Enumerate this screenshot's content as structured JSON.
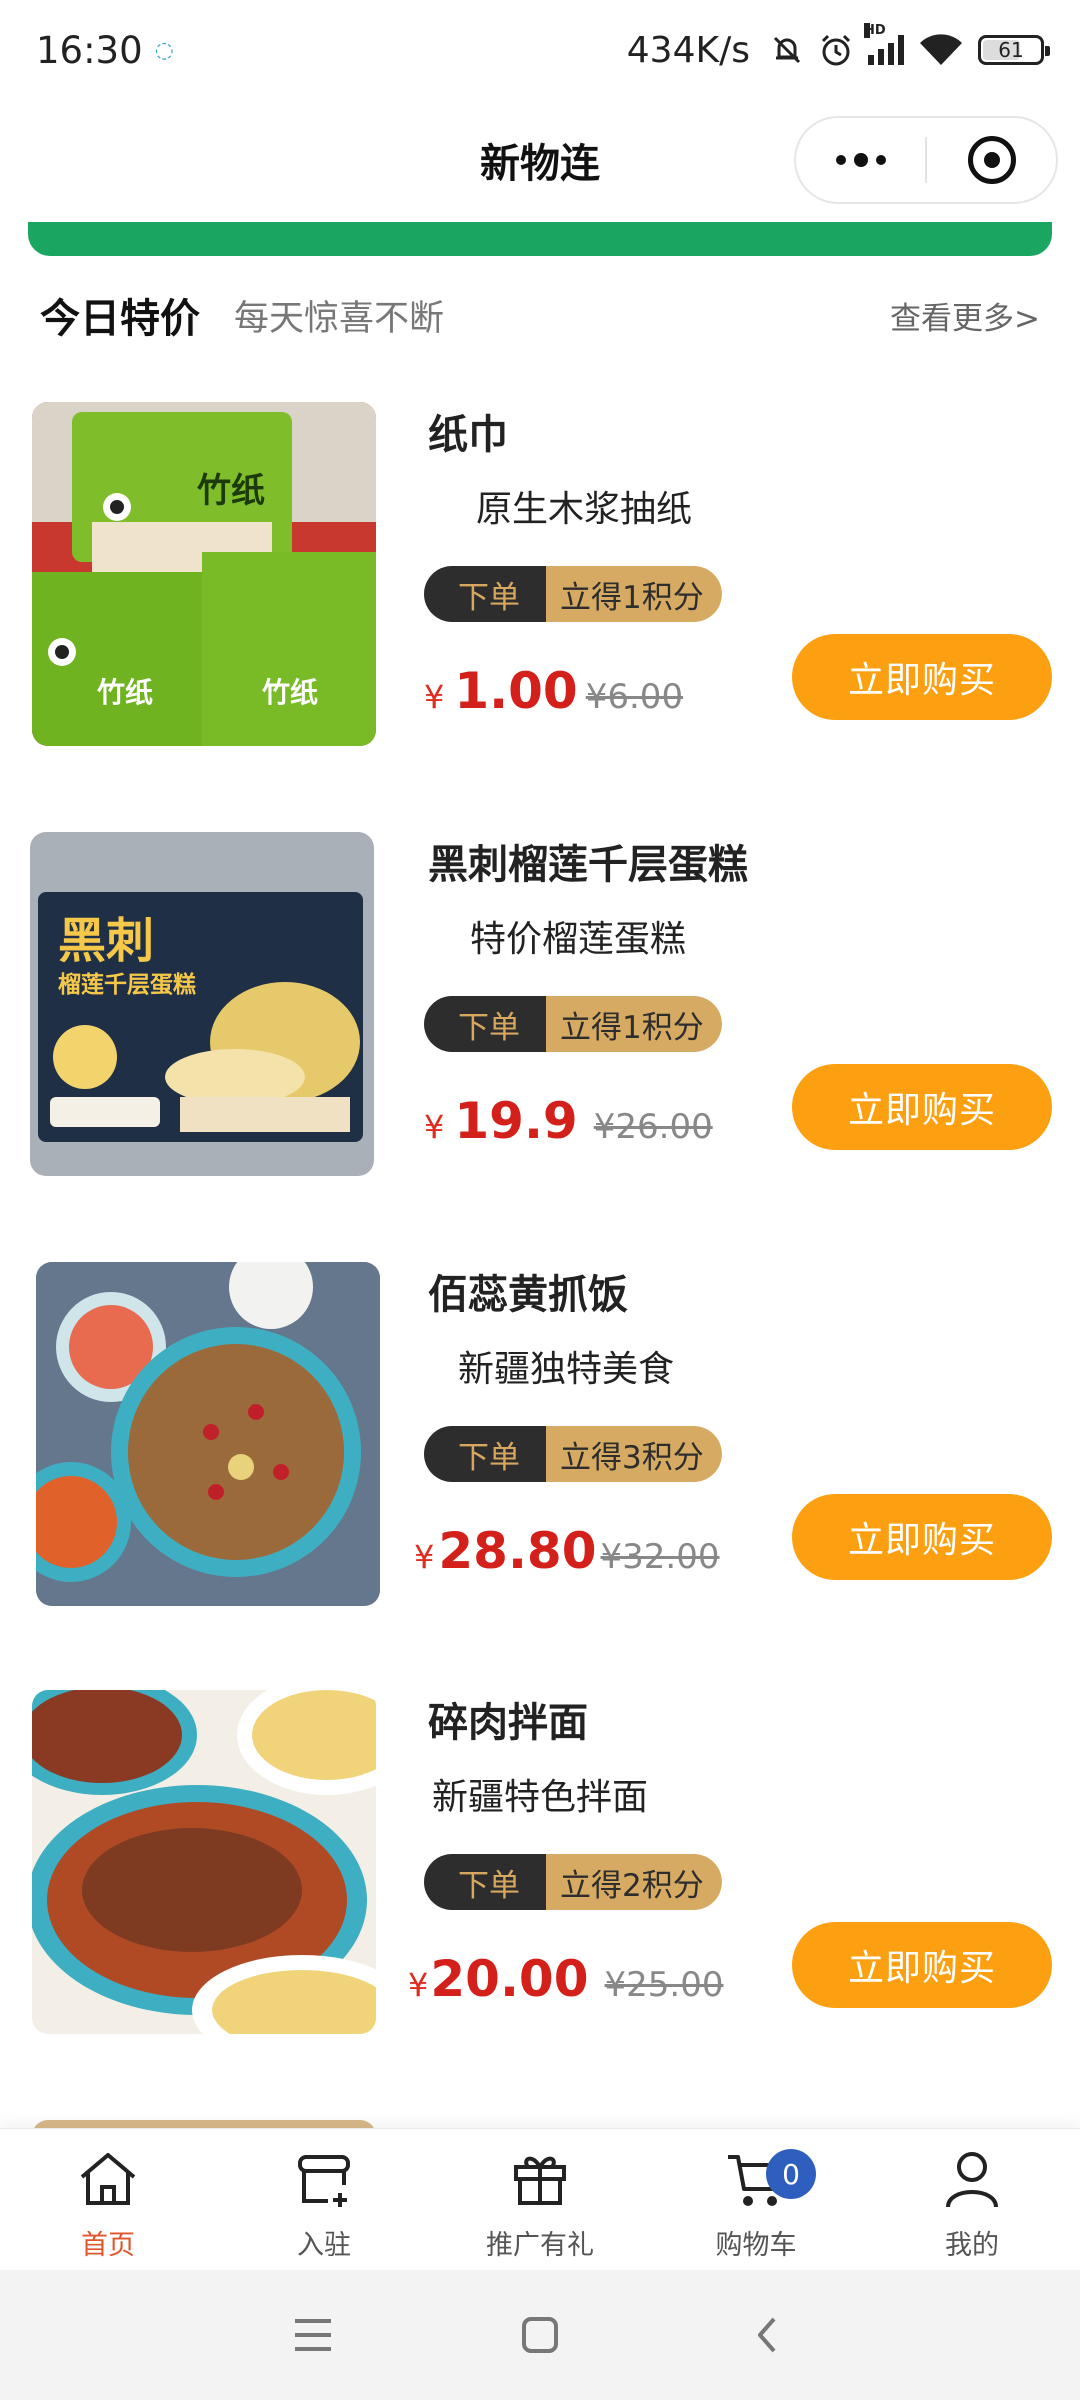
{
  "status_bar": {
    "time": "16:30",
    "network_speed": "434K/s",
    "signal_label": "HD",
    "battery_level": "61"
  },
  "header": {
    "title": "新物连"
  },
  "section": {
    "title": "今日特价",
    "subtitle": "每天惊喜不断",
    "more_link": "查看更多>"
  },
  "products": [
    {
      "name": "纸巾",
      "description": "原生木浆抽纸",
      "order_label": "下单",
      "points_label": "立得1积分",
      "currency": "¥",
      "price": "1.00",
      "original_price": "¥6.00",
      "buy_label": "立即购买",
      "image_label": "竹纸"
    },
    {
      "name": "黑刺榴莲千层蛋糕",
      "description": "特价榴莲蛋糕",
      "order_label": "下单",
      "points_label": "立得1积分",
      "currency": "¥",
      "price": "19.9",
      "original_price": "¥26.00",
      "buy_label": "立即购买",
      "image_label": "黑刺",
      "image_sublabel": "榴莲千层蛋糕"
    },
    {
      "name": "佰蕊黄抓饭",
      "description": "新疆独特美食",
      "order_label": "下单",
      "points_label": "立得3积分",
      "currency": "¥",
      "price": "28.80",
      "original_price": "¥32.00",
      "buy_label": "立即购买"
    },
    {
      "name": "碎肉拌面",
      "description": "新疆特色拌面",
      "order_label": "下单",
      "points_label": "立得2积分",
      "currency": "¥",
      "price": "20.00",
      "original_price": "¥25.00",
      "buy_label": "立即购买"
    }
  ],
  "tab_bar": {
    "tabs": [
      {
        "label": "首页",
        "icon": "home-icon",
        "active": true
      },
      {
        "label": "入驻",
        "icon": "store-add-icon",
        "active": false
      },
      {
        "label": "推广有礼",
        "icon": "gift-icon",
        "active": false
      },
      {
        "label": "购物车",
        "icon": "cart-icon",
        "active": false
      },
      {
        "label": "我的",
        "icon": "user-icon",
        "active": false
      }
    ],
    "cart_count": "0"
  },
  "colors": {
    "accent_orange": "#fca011",
    "price_red": "#d4201b",
    "banner_green": "#1aa660",
    "active_tab": "#e0552b",
    "badge_blue": "#2e5fbe"
  }
}
